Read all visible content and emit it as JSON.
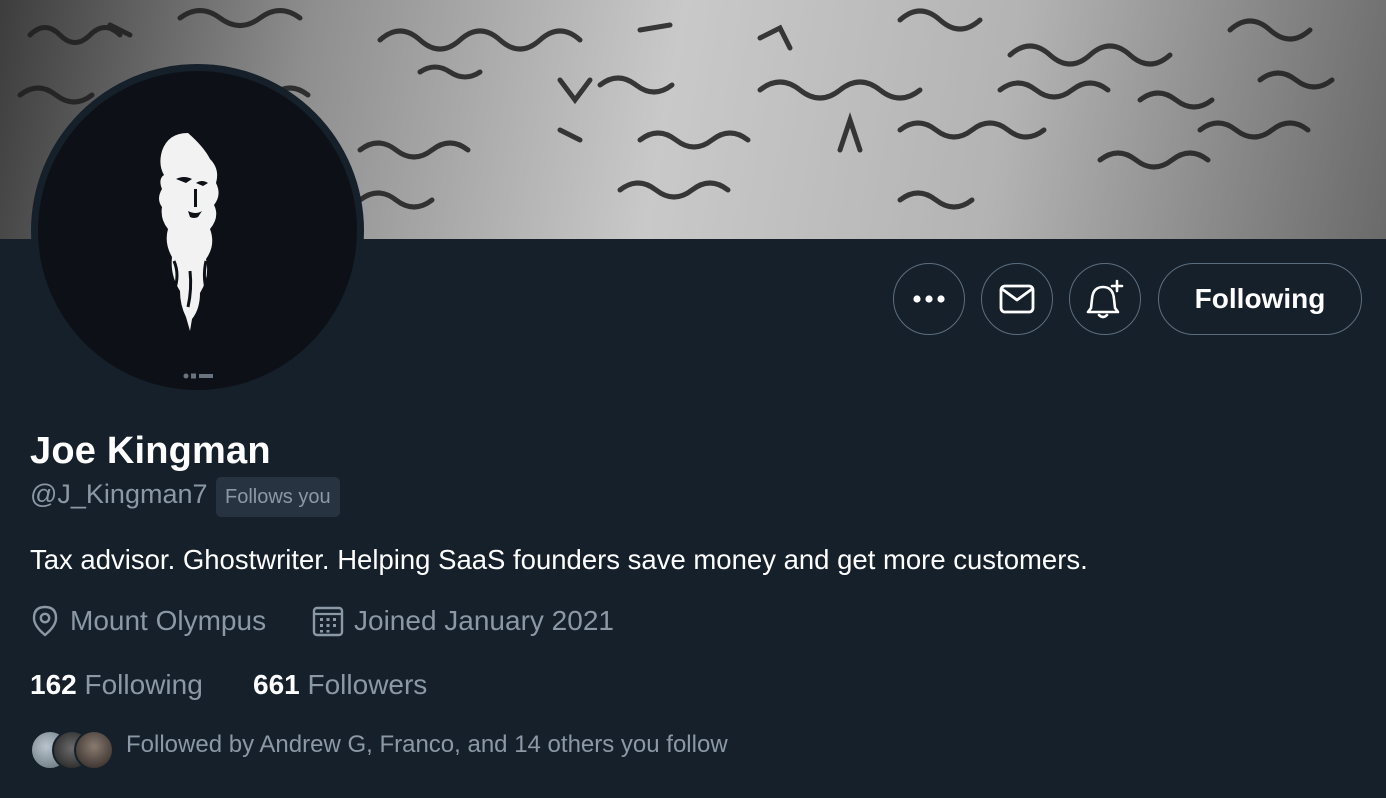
{
  "profile": {
    "name": "Joe Kingman",
    "handle": "@J_Kingman7",
    "follows_you_badge": "Follows you",
    "bio": "Tax advisor. Ghostwriter. Helping SaaS founders save money and get more customers.",
    "location": "Mount Olympus",
    "joined": "Joined January 2021",
    "following_count": "162",
    "following_label": "Following",
    "followers_count": "661",
    "followers_label": "Followers",
    "followed_by": "Followed by Andrew G, Franco, and 14 others you follow"
  },
  "actions": {
    "follow_state_label": "Following",
    "more_icon": "more-horizontal-icon",
    "message_icon": "envelope-icon",
    "notify_icon": "bell-plus-icon"
  },
  "colors": {
    "background": "#15202b",
    "secondary_text": "#8b98a5",
    "border": "#5c6e7e",
    "badge_bg": "#273340"
  }
}
